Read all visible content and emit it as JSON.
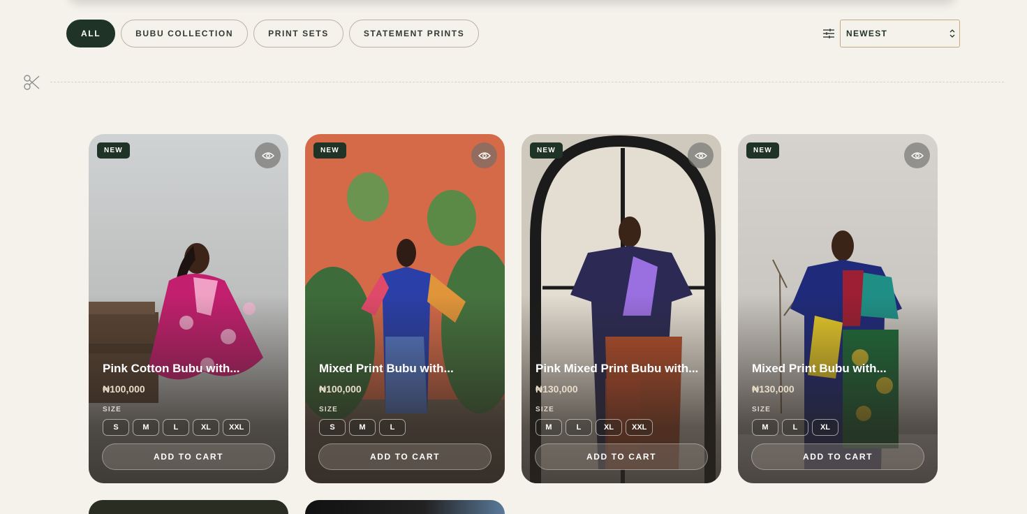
{
  "filters": [
    {
      "label": "ALL",
      "active": true
    },
    {
      "label": "BUBU COLLECTION",
      "active": false
    },
    {
      "label": "PRINT SETS",
      "active": false
    },
    {
      "label": "STATEMENT PRINTS",
      "active": false
    }
  ],
  "sort": {
    "selected": "NEWEST",
    "icon": "sliders-icon"
  },
  "divider_icon": "scissors-icon",
  "products": [
    {
      "badge": "NEW",
      "title": "Pink Cotton Bubu with...",
      "price": "₦100,000",
      "size_label": "SIZE",
      "sizes": [
        "S",
        "M",
        "L",
        "XL",
        "XXL"
      ],
      "cart_label": "ADD TO CART"
    },
    {
      "badge": "NEW",
      "title": "Mixed Print Bubu with...",
      "price": "₦100,000",
      "size_label": "SIZE",
      "sizes": [
        "S",
        "M",
        "L"
      ],
      "cart_label": "ADD TO CART"
    },
    {
      "badge": "NEW",
      "title": "Pink Mixed Print Bubu with...",
      "price": "₦130,000",
      "size_label": "SIZE",
      "sizes": [
        "M",
        "L",
        "XL",
        "XXL"
      ],
      "cart_label": "ADD TO CART"
    },
    {
      "badge": "NEW",
      "title": "Mixed Print Bubu with...",
      "price": "₦130,000",
      "size_label": "SIZE",
      "sizes": [
        "M",
        "L",
        "XL"
      ],
      "cart_label": "ADD TO CART"
    }
  ],
  "colors": {
    "brand": "#1f3326",
    "background": "#f5f2eb",
    "accent_border": "#c5a980"
  }
}
